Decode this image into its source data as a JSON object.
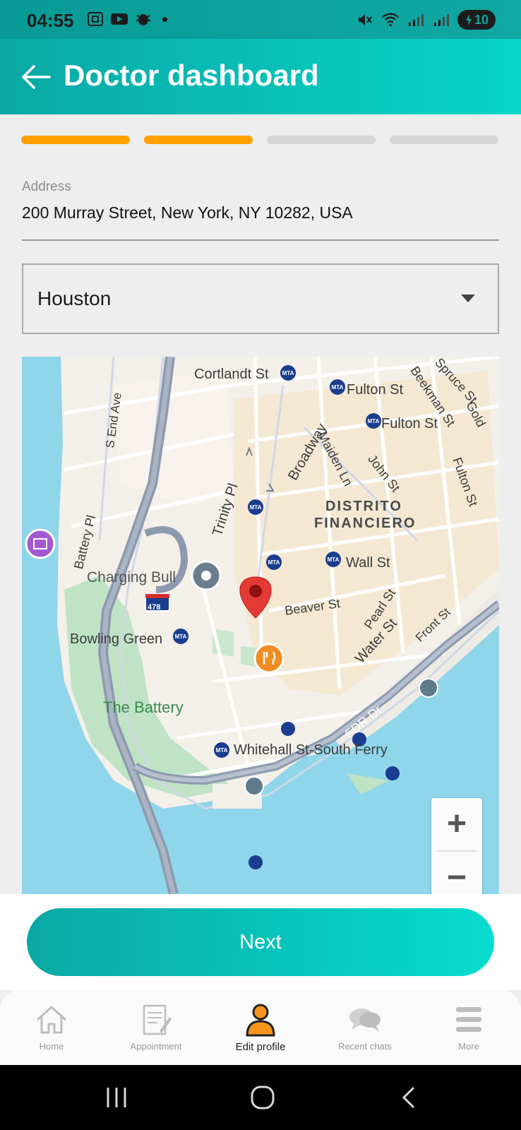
{
  "status_bar": {
    "time": "04:55",
    "battery": "10",
    "left_icons": [
      "screenshot-icon",
      "youtube-icon",
      "bug-icon"
    ],
    "right_icons": [
      "mute-icon",
      "wifi-icon",
      "signal-icon",
      "signal-icon"
    ]
  },
  "app_bar": {
    "title": "Doctor dashboard",
    "back_icon": "arrow-left-icon"
  },
  "progress": {
    "steps_total": 4,
    "steps_done": 2,
    "active_color": "#FFA000",
    "inactive_color": "#D6D6D6"
  },
  "address": {
    "label": "Address",
    "value": "200 Murray Street, New York, NY 10282, USA"
  },
  "city_select": {
    "value": "Houston"
  },
  "map": {
    "labels": {
      "cortlandt": "Cortlandt St",
      "fulton1": "Fulton St",
      "fulton2": "Fulton St",
      "spruce": "Spruce St",
      "beekman": "Beekman St",
      "gold": "Gold",
      "send": "S End Ave",
      "broadway": "Broadway",
      "maiden": "Maiden Ln",
      "john": "John St",
      "fulton_st_road": "Fulton St",
      "trinity": "Trinity Pl",
      "district1": "DISTRITO",
      "district2": "FINANCIERO",
      "battery_pl": "Battery Pl",
      "wall": "Wall St",
      "charging_bull": "Charging Bull",
      "beaver": "Beaver St",
      "pearl": "Pearl St",
      "water": "Water St",
      "front": "Front St",
      "bowling": "Bowling Green",
      "highway": "478",
      "battery_park": "The Battery",
      "fdr": "FDR Dr",
      "whitehall": "Whitehall St-South Ferry"
    },
    "zoom_in": "+",
    "zoom_out": "−"
  },
  "next_button": {
    "label": "Next"
  },
  "bottom_nav": {
    "items": [
      {
        "label": "Home",
        "icon": "home-icon"
      },
      {
        "label": "Appointment",
        "icon": "appointment-icon"
      },
      {
        "label": "Edit profile",
        "icon": "person-icon"
      },
      {
        "label": "Recent chats",
        "icon": "chat-icon"
      },
      {
        "label": "More",
        "icon": "menu-icon"
      }
    ],
    "active_index": 2
  },
  "colors": {
    "brand_start": "#0AA8A5",
    "brand_end": "#08DCCF",
    "accent": "#FFA000"
  }
}
